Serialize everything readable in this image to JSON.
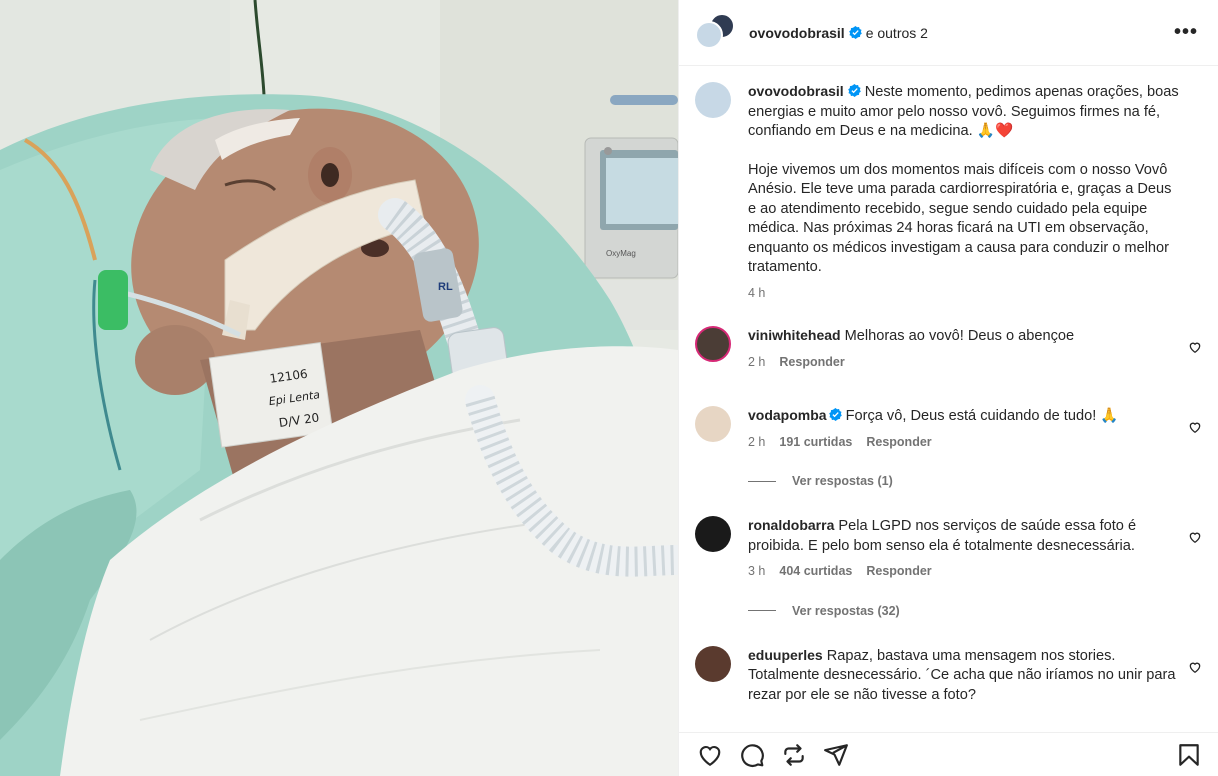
{
  "post": {
    "author": "ovovodobrasil",
    "collab_text": "e outros 2",
    "more_label": "•••"
  },
  "caption": {
    "username": "ovovodobrasil",
    "paragraph1": "Neste momento, pedimos apenas orações, boas energias e muito amor pelo nosso vovô. Seguimos firmes na fé, confiando em Deus e na medicina. 🙏❤️",
    "paragraph2": "Hoje vivemos um dos momentos mais difíceis com o nosso Vovô Anésio. Ele teve uma parada cardiorrespiratória e, graças a Deus e ao atendimento recebido, segue sendo cuidado pela equipe médica. Nas próximas 24 horas ficará na UTI em observação, enquanto os médicos investigam a causa para conduzir o melhor tratamento.",
    "time": "4 h"
  },
  "comments": [
    {
      "username": "viniwhitehead",
      "text": "Melhoras ao vovô! Deus o abençoe",
      "time": "2 h",
      "likes": "",
      "reply_label": "Responder"
    },
    {
      "username": "vodapomba",
      "text": "Força vô, Deus está cuidando de tudo! 🙏",
      "time": "2 h",
      "likes": "191 curtidas",
      "reply_label": "Responder",
      "view_replies": "Ver respostas (1)"
    },
    {
      "username": "ronaldobarra",
      "text": "Pela LGPD nos serviços de saúde essa foto é proibida. E pelo bom senso ela é totalmente desnecessária.",
      "time": "3 h",
      "likes": "404 curtidas",
      "reply_label": "Responder",
      "view_replies": "Ver respostas (32)"
    },
    {
      "username": "eduuperles",
      "text": "Rapaz, bastava uma mensagem nos stories. Totalmente desnecessário. ´Ce acha que não iríamos no unir para rezar por ele se não tivesse a foto?"
    }
  ],
  "photo": {
    "label_lines": [
      "12106",
      "Epi Lenta",
      "D/V 20"
    ],
    "tube_tag": "RL",
    "monitor_brand": "OxyMag"
  },
  "icons": {
    "like": "heart-icon",
    "comment": "comment-icon",
    "share": "share-icon",
    "send": "send-icon",
    "save": "bookmark-icon",
    "verified": "verified-badge-icon"
  },
  "colors": {
    "verified": "#0095f6",
    "text": "#262626",
    "secondary": "#737373"
  }
}
